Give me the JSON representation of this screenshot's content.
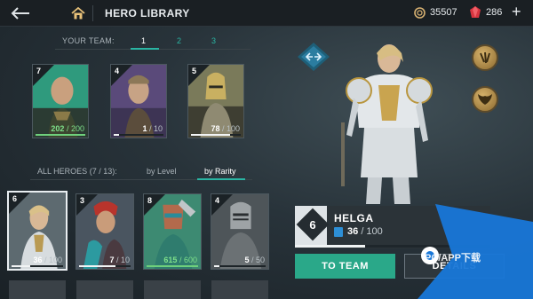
{
  "header": {
    "title": "HERO LIBRARY",
    "coins": "35507",
    "gems": "286",
    "back_icon": "back-arrow-icon",
    "home_icon": "home-icon",
    "add_icon": "plus-icon"
  },
  "team": {
    "label": "YOUR TEAM:",
    "tabs": [
      "1",
      "2",
      "3"
    ],
    "active_tab": "1",
    "cards": [
      {
        "level": "7",
        "value": "202",
        "max": "/ 200",
        "progress": 1.0,
        "full": true
      },
      {
        "level": "4",
        "value": "1",
        "max": "/ 10",
        "progress": 0.1,
        "full": false
      },
      {
        "level": "5",
        "value": "78",
        "max": "/ 100",
        "progress": 0.78,
        "full": false
      }
    ]
  },
  "heroes": {
    "label": "ALL HEROES",
    "count": "(7 / 13):",
    "sort_tabs": [
      "by Level",
      "by Rarity"
    ],
    "active_sort": "by Rarity",
    "cards": [
      {
        "level": "6",
        "value": "36",
        "max": "/ 100",
        "progress": 0.36,
        "full": false,
        "selected": true
      },
      {
        "level": "3",
        "value": "7",
        "max": "/ 10",
        "progress": 0.7,
        "full": false
      },
      {
        "level": "8",
        "value": "615",
        "max": "/ 600",
        "progress": 1.0,
        "full": true
      },
      {
        "level": "4",
        "value": "5",
        "max": "/ 50",
        "progress": 0.1,
        "full": false
      }
    ]
  },
  "selected_hero": {
    "level": "6",
    "name": "HELGA",
    "value": "36",
    "max": "/ 100",
    "progress": 0.36
  },
  "actions": {
    "to_team": "TO TEAM",
    "details": "DETAILS"
  },
  "watermark": "PC/APP下载",
  "colors": {
    "accent": "#2ab5a3",
    "to_team_button": "#2aa889",
    "full_green": "#7ee08a",
    "gem": "#e0404a",
    "watermark_blue": "#1877d8"
  }
}
